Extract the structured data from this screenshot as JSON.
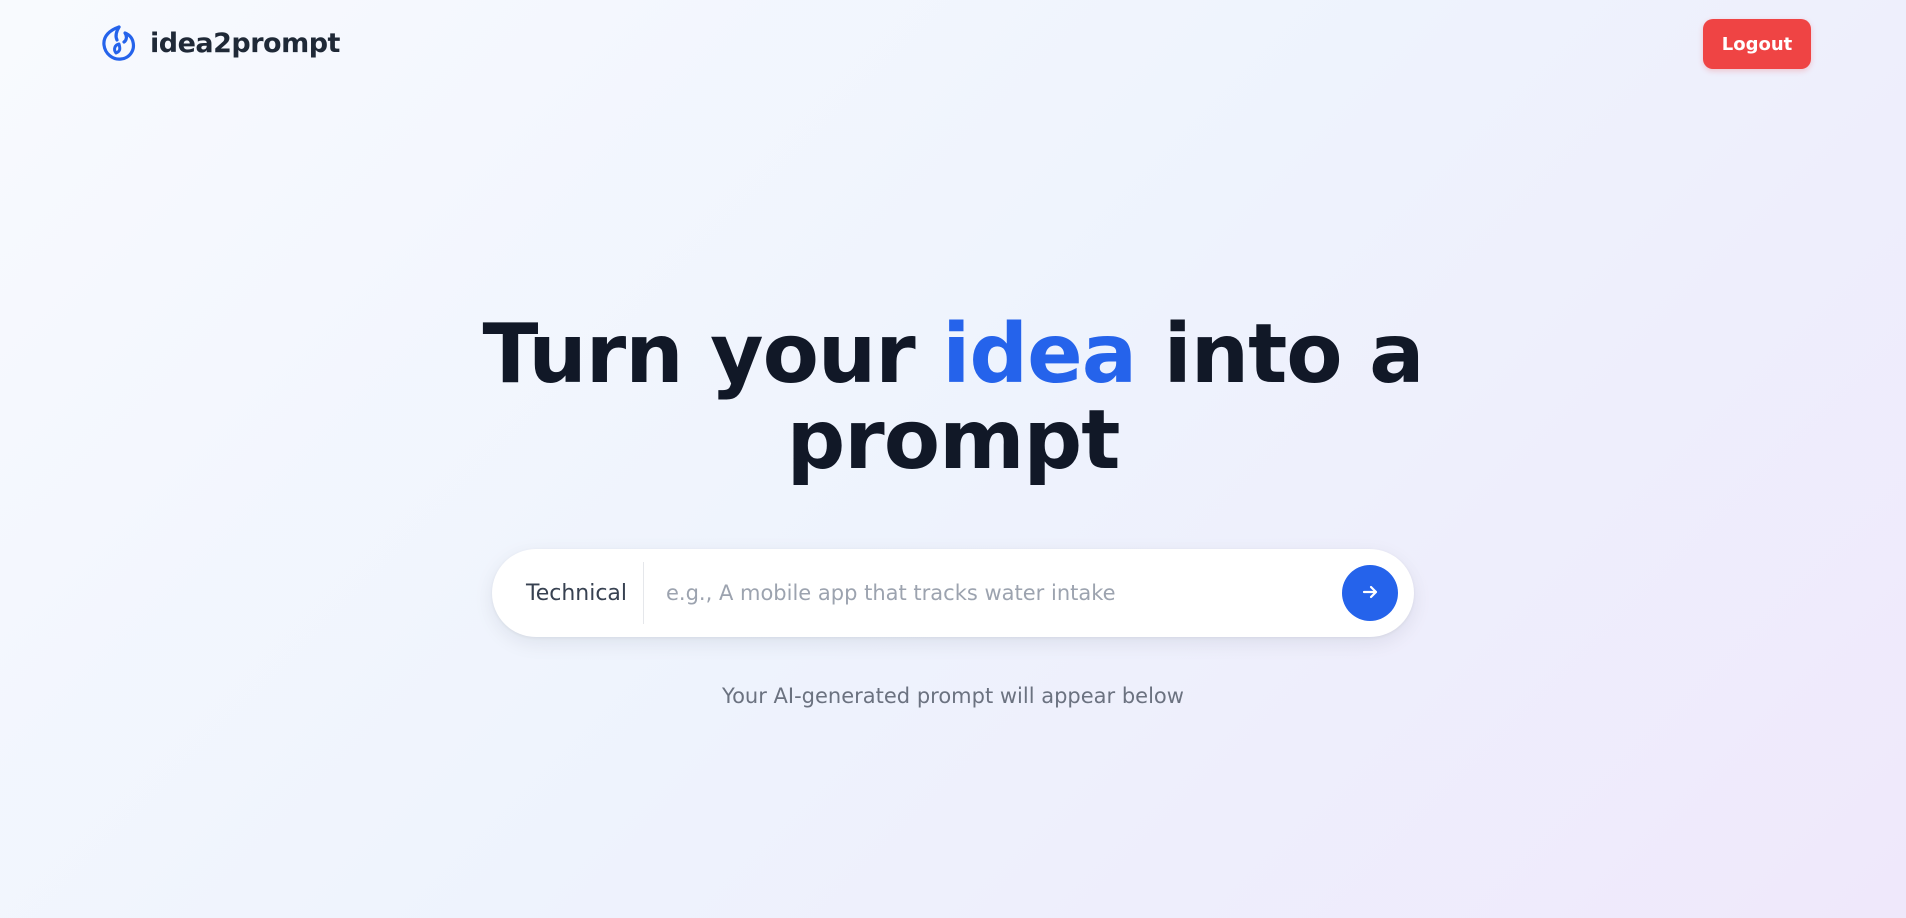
{
  "app": {
    "name": "idea2prompt",
    "logo_icon": "flame-swirl-icon"
  },
  "header": {
    "logout_label": "Logout"
  },
  "hero": {
    "title_before": "Turn your ",
    "title_accent": "idea",
    "title_after": " into a",
    "title_line2": "prompt"
  },
  "search": {
    "mode_label": "Technical",
    "input_value": "",
    "placeholder": "e.g., A mobile app that tracks water intake",
    "submit_icon": "arrow-right-icon"
  },
  "helper": {
    "text": "Your AI-generated prompt will appear below"
  },
  "colors": {
    "accent": "#2563eb",
    "logout": "#ef4444",
    "title": "#111827",
    "muted": "#6b7280"
  }
}
